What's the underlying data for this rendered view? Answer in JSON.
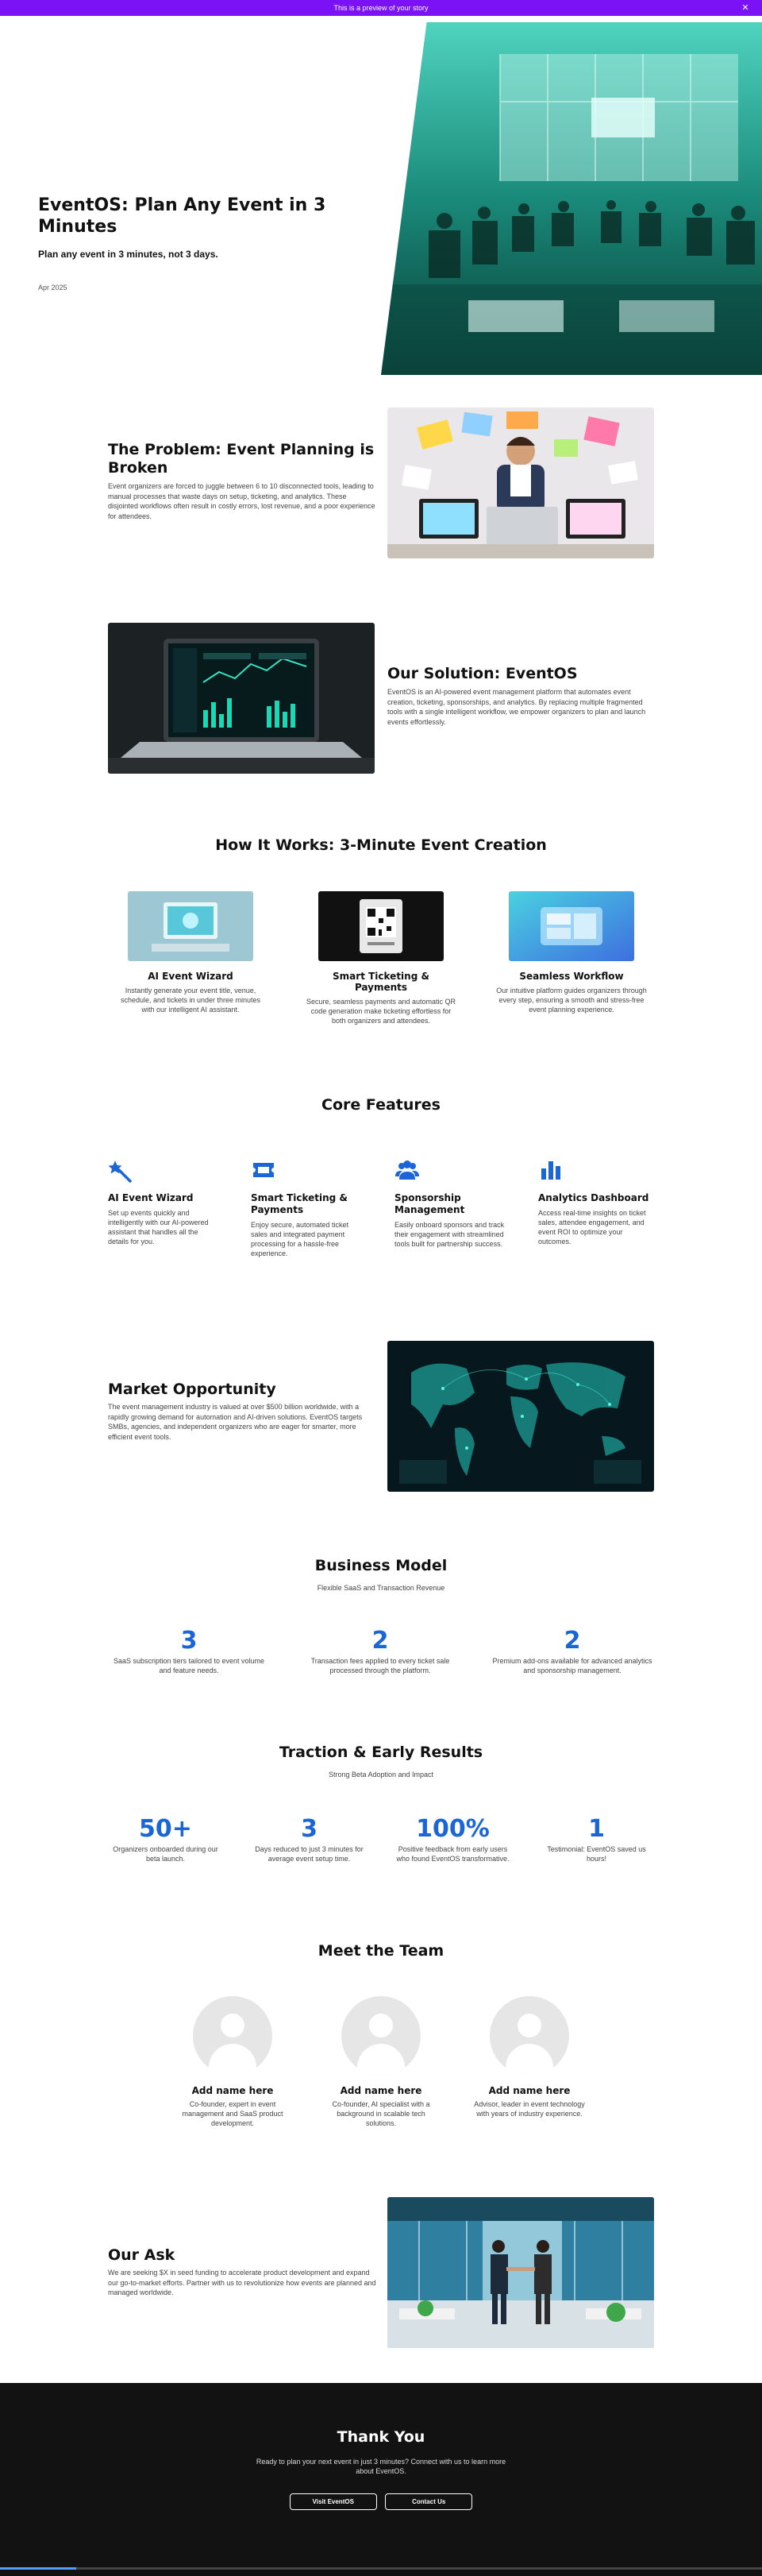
{
  "banner": {
    "text": "This is a preview of your story",
    "close_glyph": "✕",
    "bg": "#7a12f5"
  },
  "hero": {
    "title": "EventOS: Plan Any Event in 3 Minutes",
    "subtitle": "Plan any event in 3 minutes, not 3 days.",
    "date": "Apr 2025"
  },
  "problem": {
    "title": "The Problem: Event Planning is Broken",
    "body": "Event organizers are forced to juggle between 6 to 10 disconnected tools, leading to manual processes that waste days on setup, ticketing, and analytics. These disjointed workflows often result in costly errors, lost revenue, and a poor experience for attendees."
  },
  "solution": {
    "title": "Our Solution: EventOS",
    "body": "EventOS is an AI-powered event management platform that automates event creation, ticketing, sponsorships, and analytics. By replacing multiple fragmented tools with a single intelligent workflow, we empower organizers to plan and launch events effortlessly."
  },
  "how": {
    "title": "How It Works: 3-Minute Event Creation",
    "steps": [
      {
        "title": "AI Event Wizard",
        "body": "Instantly generate your event title, venue, schedule, and tickets in under three minutes with our intelligent AI assistant."
      },
      {
        "title": "Smart Ticketing & Payments",
        "body": "Secure, seamless payments and automatic QR code generation make ticketing effortless for both organizers and attendees."
      },
      {
        "title": "Seamless Workflow",
        "body": "Our intuitive platform guides organizers through every step, ensuring a smooth and stress-free event planning experience."
      }
    ]
  },
  "features": {
    "title": "Core Features",
    "items": [
      {
        "icon": "wand-icon",
        "title": "AI Event Wizard",
        "body": "Set up events quickly and intelligently with our AI-powered assistant that handles all the details for you."
      },
      {
        "icon": "ticket-icon",
        "title": "Smart Ticketing & Payments",
        "body": "Enjoy secure, automated ticket sales and integrated payment processing for a hassle-free experience."
      },
      {
        "icon": "group-icon",
        "title": "Sponsorship Management",
        "body": "Easily onboard sponsors and track their engagement with streamlined tools built for partnership success."
      },
      {
        "icon": "bar-chart-icon",
        "title": "Analytics Dashboard",
        "body": "Access real-time insights on ticket sales, attendee engagement, and event ROI to optimize your outcomes."
      }
    ],
    "accent": "#1a66d6"
  },
  "market": {
    "title": "Market Opportunity",
    "body": "The event management industry is valued at over $500 billion worldwide, with a rapidly growing demand for automation and AI-driven solutions. EventOS targets SMBs, agencies, and independent organizers who are eager for smarter, more efficient event tools."
  },
  "business": {
    "title": "Business Model",
    "subtitle": "Flexible SaaS and Transaction Revenue",
    "stats": [
      {
        "value": "3",
        "label": "SaaS subscription tiers tailored to event volume and feature needs."
      },
      {
        "value": "2",
        "label": "Transaction fees applied to every ticket sale processed through the platform."
      },
      {
        "value": "2",
        "label": "Premium add-ons available for advanced analytics and sponsorship management."
      }
    ]
  },
  "traction": {
    "title": "Traction & Early Results",
    "subtitle": "Strong Beta Adoption and Impact",
    "stats": [
      {
        "value": "50+",
        "label": "Organizers onboarded during our beta launch."
      },
      {
        "value": "3",
        "label": "Days reduced to just 3 minutes for average event setup time."
      },
      {
        "value": "100%",
        "label": "Positive feedback from early users who found EventOS transformative."
      },
      {
        "value": "1",
        "label": "Testimonial: EventOS saved us hours!"
      }
    ]
  },
  "team": {
    "title": "Meet the Team",
    "members": [
      {
        "name": "Add name here",
        "bio": "Co-founder, expert in event management and SaaS product development."
      },
      {
        "name": "Add name here",
        "bio": "Co-founder, AI specialist with a background in scalable tech solutions."
      },
      {
        "name": "Add name here",
        "bio": "Advisor, leader in event technology with years of industry experience."
      }
    ]
  },
  "ask": {
    "title": "Our Ask",
    "body": "We are seeking $X in seed funding to accelerate product development and expand our go-to-market efforts. Partner with us to revolutionize how events are planned and managed worldwide."
  },
  "thanks": {
    "title": "Thank You",
    "body": "Ready to plan your next event in just 3 minutes? Connect with us to learn more about EventOS.",
    "btn1": "Visit EventOS",
    "btn2": "Contact Us"
  }
}
